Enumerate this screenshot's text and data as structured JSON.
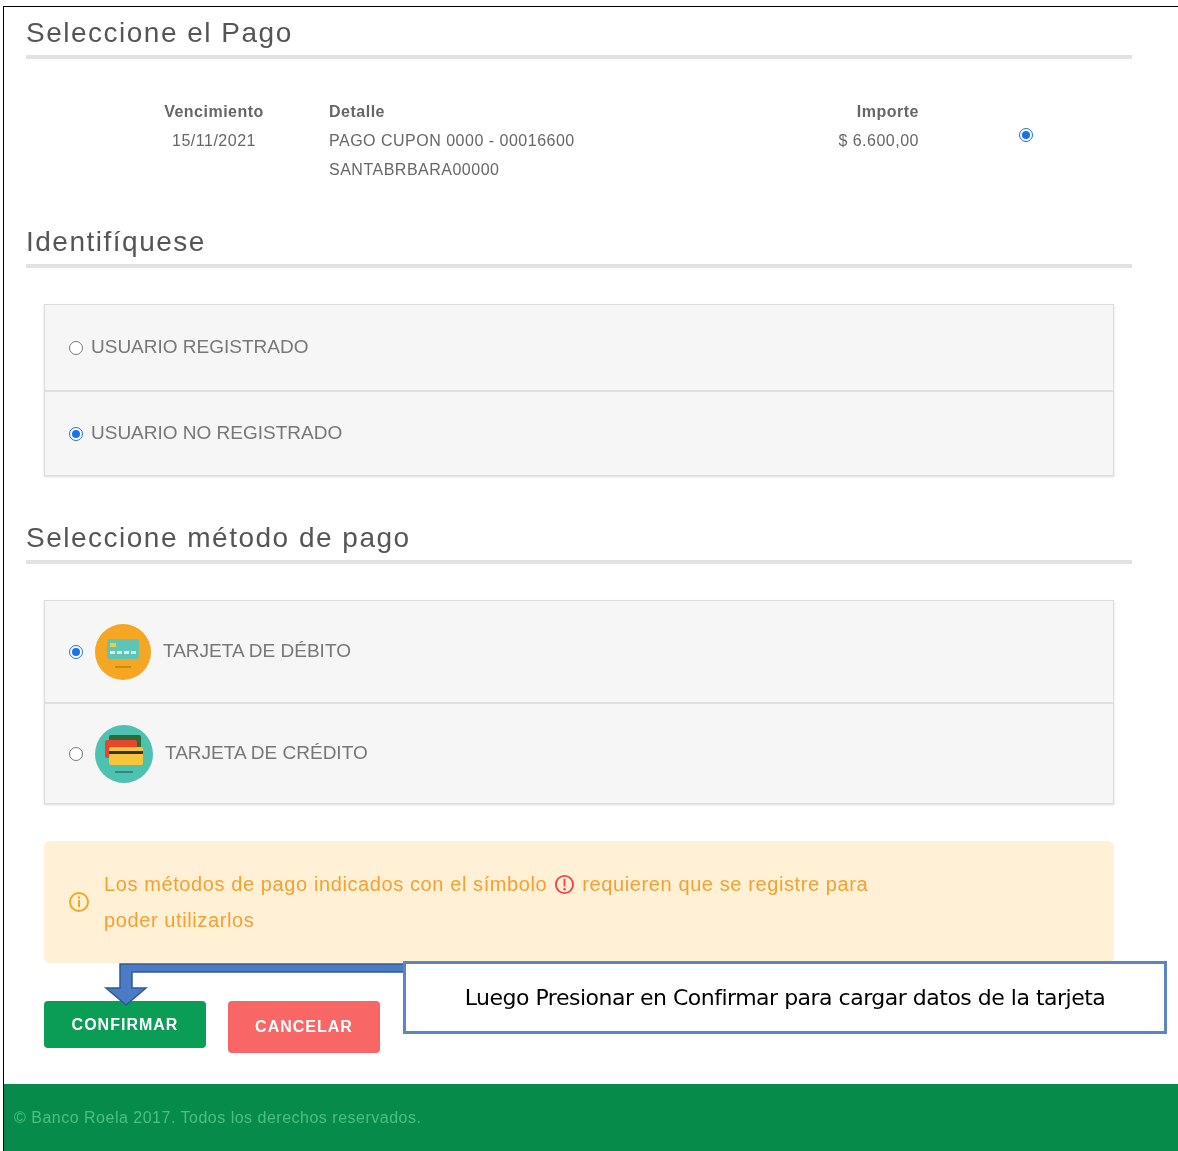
{
  "payment_section": {
    "title": "Seleccione el Pago",
    "columns": [
      "Vencimiento",
      "Detalle",
      "Importe"
    ],
    "rows": [
      {
        "due_date": "15/11/2021",
        "detail": [
          "PAGO CUPON 0000 - 00016600",
          "SANTABRBARA00000"
        ],
        "amount": "$ 6.600,00",
        "selected": true
      }
    ]
  },
  "identify_section": {
    "title": "Identifíquese",
    "options": [
      {
        "label": "USUARIO REGISTRADO",
        "selected": false
      },
      {
        "label": "USUARIO NO REGISTRADO",
        "selected": true
      }
    ]
  },
  "method_section": {
    "title": "Seleccione método de pago",
    "options": [
      {
        "label": "TARJETA DE DÉBITO",
        "kind": "debit",
        "selected": true
      },
      {
        "label": "TARJETA DE CRÉDITO",
        "kind": "credit",
        "selected": false
      }
    ]
  },
  "notice": {
    "text_before": "Los métodos de pago indicados con el símbolo",
    "text_after": "requieren que se registre para",
    "text_line_2": "poder utilizarlos"
  },
  "buttons": [
    {
      "label": "CONFIRMAR",
      "kind": "primary"
    },
    {
      "label": "CANCELAR",
      "kind": "danger"
    }
  ],
  "callout": {
    "text": "Luego Presionar en Confirmar para cargar datos de la tarjeta"
  },
  "footer": {
    "text": "© Banco Roela 2017. Todos los derechos reservados."
  }
}
